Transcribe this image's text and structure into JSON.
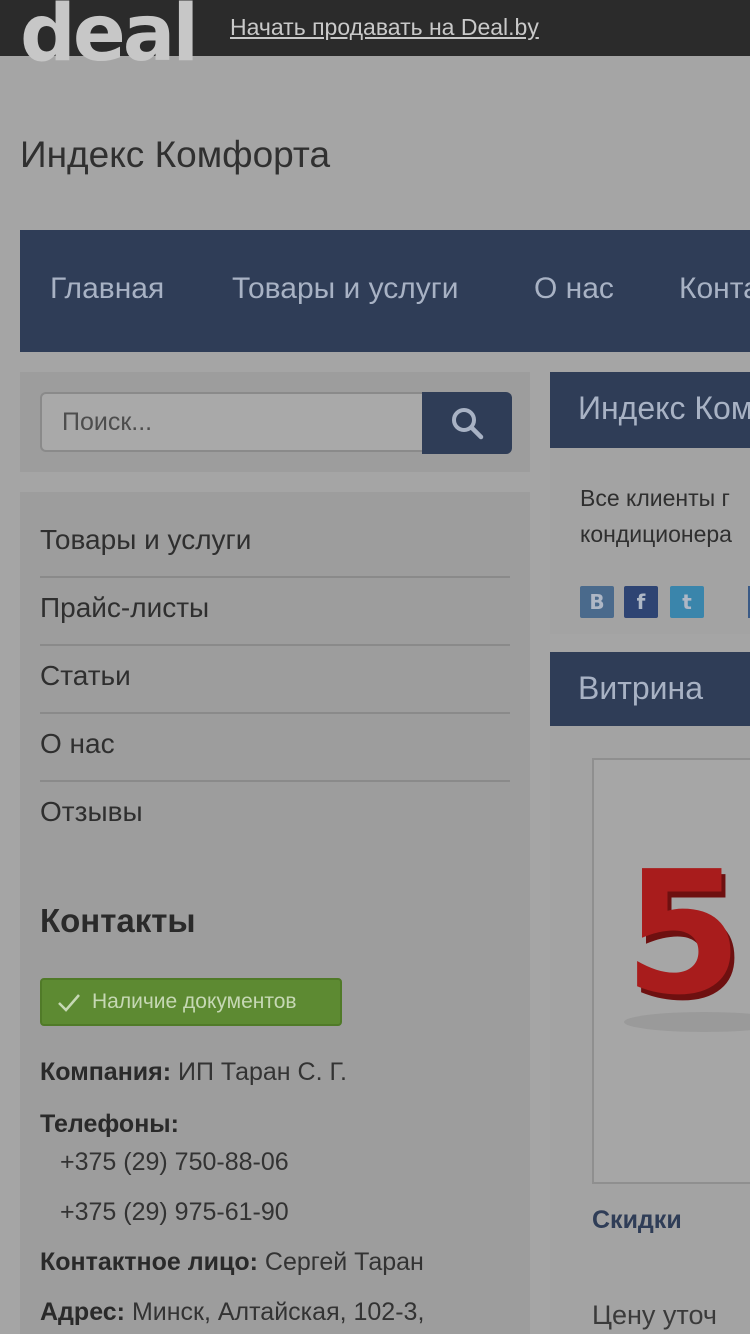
{
  "topbar": {
    "logo": "deal",
    "sell_link": "Начать продавать на Deal.by"
  },
  "site_title": "Индекс Комфорта",
  "nav": {
    "items": [
      {
        "label": "Главная"
      },
      {
        "label": "Товары и услуги"
      },
      {
        "label": "О нас"
      },
      {
        "label": "Конта"
      }
    ]
  },
  "search": {
    "placeholder": "Поиск...",
    "icon": "search-icon"
  },
  "sidebar": {
    "items": [
      {
        "label": "Товары и услуги"
      },
      {
        "label": "Прайс-листы"
      },
      {
        "label": "Статьи"
      },
      {
        "label": "О нас"
      },
      {
        "label": "Отзывы"
      }
    ],
    "contacts_title": "Контакты",
    "docs_badge": "Наличие документов",
    "company_label": "Компания:",
    "company_value": "ИП Таран С. Г.",
    "phones_label": "Телефоны:",
    "phones": [
      "+375 (29) 750-88-06",
      "+375 (29) 975-61-90"
    ],
    "contact_label": "Контактное лицо:",
    "contact_value": "Сергей Таран",
    "address_label": "Адрес:",
    "address_value": "Минск, Алтайская, 102-3,"
  },
  "about": {
    "title": "Индекс Ком",
    "text_line1": "Все клиенты г",
    "text_line2": "кондиционера",
    "share": [
      {
        "name": "vk-icon",
        "glyph": "В",
        "color": "#4a6a8c"
      },
      {
        "name": "facebook-icon",
        "glyph": "f",
        "color": "#2e4473"
      },
      {
        "name": "twitter-icon",
        "glyph": "t",
        "color": "#3a85ab"
      }
    ]
  },
  "vitrina": {
    "title": "Витрина",
    "product_image_text": "5",
    "product_name": "Скидки",
    "product_price": "Цену уточ"
  },
  "colors": {
    "nav_bg": "#2f3d57",
    "badge_green": "#5d8a32",
    "product_red": "#a81c1c"
  }
}
